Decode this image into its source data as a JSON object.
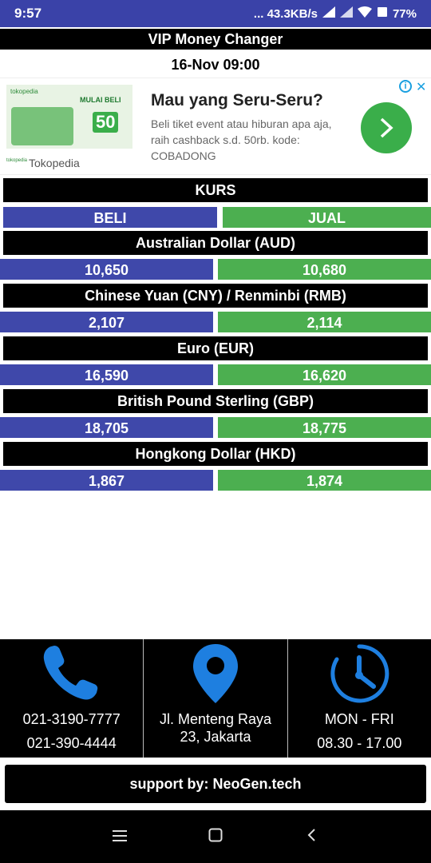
{
  "statusbar": {
    "time": "9:57",
    "network_speed": "... 43.3KB/s",
    "battery": "77%",
    "icons": [
      "signal-icon",
      "signal-icon",
      "wifi-icon",
      "battery-icon"
    ]
  },
  "app": {
    "title": "VIP Money Changer",
    "datetime": "16-Nov 09:00"
  },
  "ad": {
    "image_brand": "tokopedia",
    "image_promo_line": "MULAI BELI",
    "image_promo_value": "50",
    "title": "Mau yang Seru-Seru?",
    "description": "Beli tiket event atau hiburan apa aja, raih cashback s.d. 50rb. kode: COBADONG",
    "advertiser": "Tokopedia",
    "accent_color": "#3aae4a"
  },
  "kurs": {
    "label": "KURS",
    "buy_label": "BELI",
    "sell_label": "JUAL"
  },
  "rates": [
    {
      "name": "Australian Dollar (AUD)",
      "buy": "10,650",
      "sell": "10,680"
    },
    {
      "name": "Chinese Yuan (CNY) / Renminbi (RMB)",
      "buy": "2,107",
      "sell": "2,114"
    },
    {
      "name": "Euro (EUR)",
      "buy": "16,590",
      "sell": "16,620"
    },
    {
      "name": "British Pound Sterling (GBP)",
      "buy": "18,705",
      "sell": "18,775"
    },
    {
      "name": "Hongkong Dollar (HKD)",
      "buy": "1,867",
      "sell": "1,874"
    }
  ],
  "contact": {
    "phone": {
      "icon": "phone-icon",
      "line1": "021-3190-7777",
      "line2": "021-390-4444"
    },
    "address": {
      "icon": "location-pin-icon",
      "line1": "Jl. Menteng Raya",
      "line2": "23, Jakarta"
    },
    "hours": {
      "icon": "clock-icon",
      "line1": "MON - FRI",
      "line2": "08.30 - 17.00"
    }
  },
  "support": {
    "label": "support by: NeoGen.tech"
  },
  "navbar": {
    "icons": [
      "menu-icon",
      "home-icon",
      "back-icon"
    ]
  },
  "colors": {
    "buy": "#3f48aa",
    "sell": "#4caf50",
    "statusbar": "#3a42a8",
    "icon_blue": "#1e7fe0"
  }
}
